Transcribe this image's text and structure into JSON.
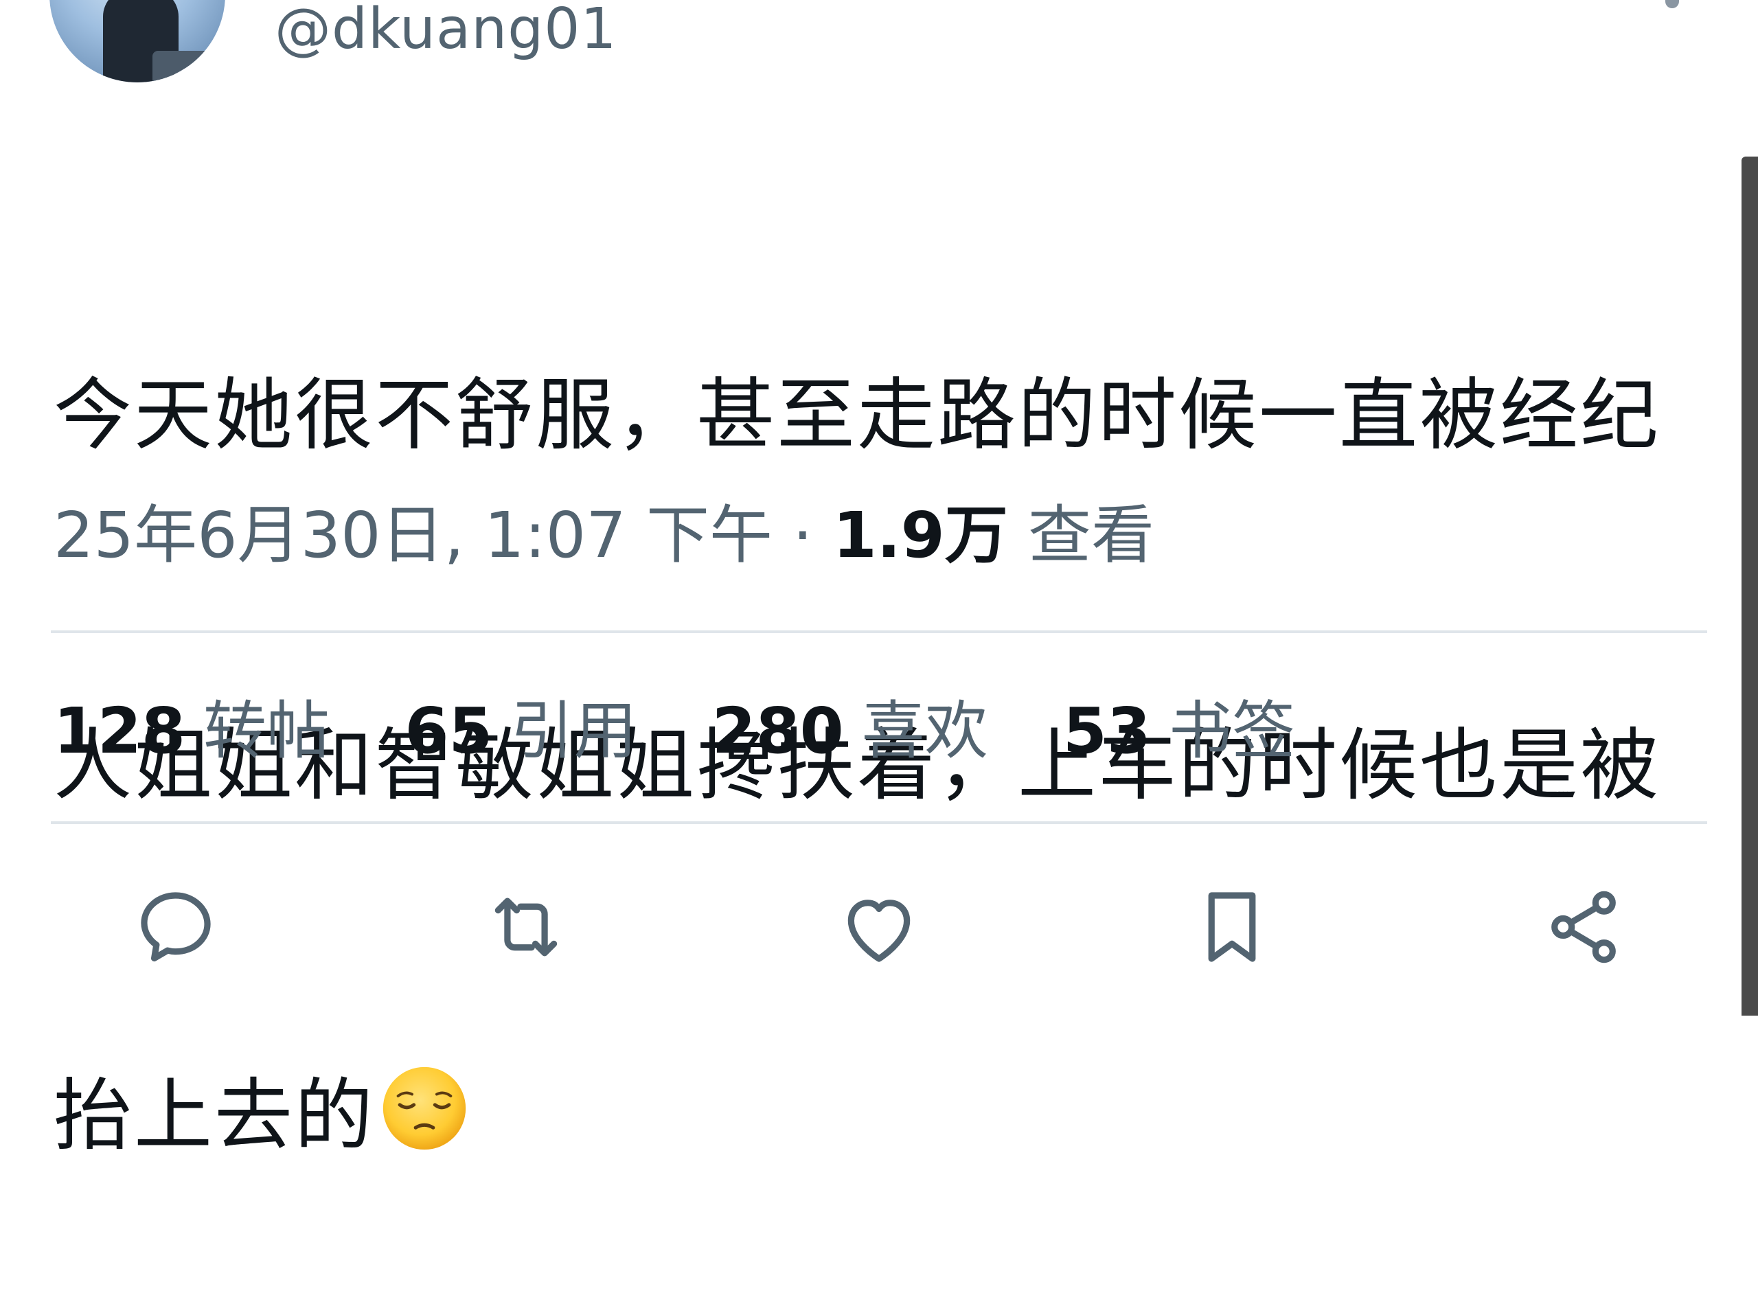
{
  "author": {
    "handle": "@dkuang01"
  },
  "tweet": {
    "lines": [
      "今天她很不舒服，甚至走路的时候一直被经纪",
      "人姐姐和智敏姐姐搀扶着，上车的时候也是被",
      "抬上去的"
    ],
    "emoji": "pensive-face-emoji"
  },
  "meta": {
    "timestamp": "25年6月30日, 1:07 下午",
    "separator": "·",
    "views_count": "1.9万",
    "views_label": "查看"
  },
  "stats": [
    {
      "count": "128",
      "label": "转帖"
    },
    {
      "count": "65",
      "label": "引用"
    },
    {
      "count": "280",
      "label": "喜欢"
    },
    {
      "count": "53",
      "label": "书签"
    }
  ],
  "actions": [
    {
      "icon": "reply-icon"
    },
    {
      "icon": "retweet-icon"
    },
    {
      "icon": "like-icon"
    },
    {
      "icon": "bookmark-icon"
    },
    {
      "icon": "share-icon"
    }
  ],
  "colors": {
    "text_primary": "#0f1419",
    "text_secondary": "#536471",
    "divider": "#dfe5ea",
    "emoji_face": "#ffcc33"
  }
}
